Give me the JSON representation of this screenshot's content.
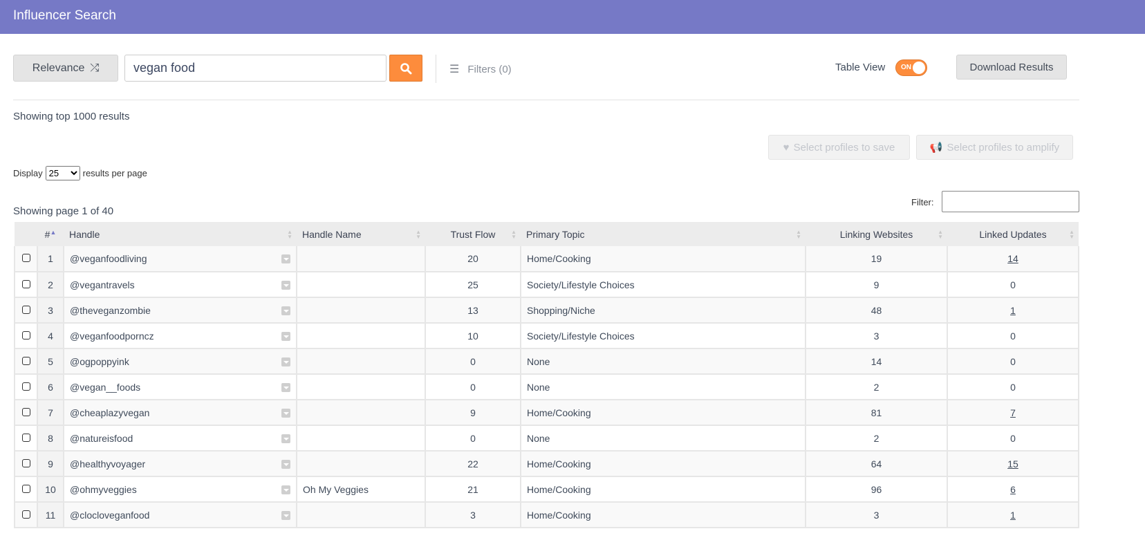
{
  "header": {
    "title": "Influencer Search"
  },
  "toolbar": {
    "sort_label": "Relevance",
    "search_value": "vegan food",
    "filters_label": "Filters (0)",
    "table_view_label": "Table View",
    "toggle_state": "ON",
    "download_label": "Download Results"
  },
  "results": {
    "summary": "Showing top 1000 results",
    "save_label": "Select profiles to save",
    "amplify_label": "Select profiles to amplify",
    "display_label": "Display",
    "per_page": "25",
    "per_page_suffix": "results per page",
    "page_info": "Showing page 1 of 40",
    "filter_label": "Filter:"
  },
  "colors": {
    "header": "#7679c6",
    "accent": "#fd8c3c"
  },
  "table": {
    "columns": [
      "#",
      "Handle",
      "Handle Name",
      "Trust Flow",
      "Primary Topic",
      "Linking Websites",
      "Linked Updates"
    ],
    "rows": [
      {
        "n": "1",
        "handle": "@veganfoodliving",
        "name": "",
        "tf": "20",
        "topic": "Home/Cooking",
        "lw": "19",
        "lu": "14",
        "link": true
      },
      {
        "n": "2",
        "handle": "@vegantravels",
        "name": "",
        "tf": "25",
        "topic": "Society/Lifestyle Choices",
        "lw": "9",
        "lu": "0",
        "link": false
      },
      {
        "n": "3",
        "handle": "@theveganzombie",
        "name": "",
        "tf": "13",
        "topic": "Shopping/Niche",
        "lw": "48",
        "lu": "1",
        "link": true
      },
      {
        "n": "4",
        "handle": "@veganfoodporncz",
        "name": "",
        "tf": "10",
        "topic": "Society/Lifestyle Choices",
        "lw": "3",
        "lu": "0",
        "link": false
      },
      {
        "n": "5",
        "handle": "@ogpoppyink",
        "name": "",
        "tf": "0",
        "topic": "None",
        "lw": "14",
        "lu": "0",
        "link": false
      },
      {
        "n": "6",
        "handle": "@vegan__foods",
        "name": "",
        "tf": "0",
        "topic": "None",
        "lw": "2",
        "lu": "0",
        "link": false
      },
      {
        "n": "7",
        "handle": "@cheaplazyvegan",
        "name": "",
        "tf": "9",
        "topic": "Home/Cooking",
        "lw": "81",
        "lu": "7",
        "link": true
      },
      {
        "n": "8",
        "handle": "@natureisfood",
        "name": "",
        "tf": "0",
        "topic": "None",
        "lw": "2",
        "lu": "0",
        "link": false
      },
      {
        "n": "9",
        "handle": "@healthyvoyager",
        "name": "",
        "tf": "22",
        "topic": "Home/Cooking",
        "lw": "64",
        "lu": "15",
        "link": true
      },
      {
        "n": "10",
        "handle": "@ohmyveggies",
        "name": "Oh My Veggies",
        "tf": "21",
        "topic": "Home/Cooking",
        "lw": "96",
        "lu": "6",
        "link": true
      },
      {
        "n": "11",
        "handle": "@clocloveganfood",
        "name": "",
        "tf": "3",
        "topic": "Home/Cooking",
        "lw": "3",
        "lu": "1",
        "link": true
      }
    ]
  }
}
